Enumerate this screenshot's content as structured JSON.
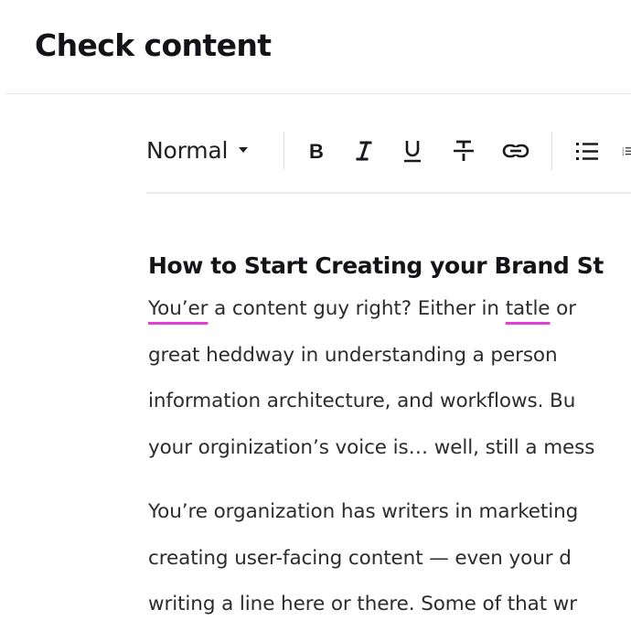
{
  "header": {
    "title": "Check content"
  },
  "toolbar": {
    "format_selected": "Normal",
    "buttons": [
      {
        "name": "bold",
        "icon": "bold-icon"
      },
      {
        "name": "italic",
        "icon": "italic-icon"
      },
      {
        "name": "underline",
        "icon": "underline-icon"
      },
      {
        "name": "strikethrough",
        "icon": "strikethrough-icon"
      },
      {
        "name": "link",
        "icon": "link-icon"
      },
      {
        "name": "bulleted-list",
        "icon": "bulleted-list-icon"
      },
      {
        "name": "numbered-list",
        "icon": "numbered-list-icon"
      }
    ]
  },
  "editor": {
    "heading": "How to Start Creating your Brand St",
    "paragraphs": [
      {
        "lines": [
          {
            "segments": [
              {
                "text": "You’er",
                "misspelled": true
              },
              {
                "text": " a content guy right? Either in "
              },
              {
                "text": "tatle",
                "misspelled": true
              },
              {
                "text": " or"
              }
            ]
          },
          {
            "segments": [
              {
                "text": "great heddway in understanding a person"
              }
            ]
          },
          {
            "segments": [
              {
                "text": "information architecture, and workflows. Bu"
              }
            ]
          },
          {
            "segments": [
              {
                "text": "your orginization’s voice is… well, still a mess"
              }
            ]
          }
        ]
      },
      {
        "lines": [
          {
            "segments": [
              {
                "text": "You’re organization has writers in marketing"
              }
            ]
          },
          {
            "segments": [
              {
                "text": "creating user-facing content — even your d"
              }
            ]
          },
          {
            "segments": [
              {
                "text": "writing a line here or there. Some of that wr"
              }
            ]
          }
        ]
      }
    ]
  },
  "colors": {
    "spellcheck_underline": "#e23fd6",
    "divider": "#e8e8ec",
    "text": "#2b2b30",
    "title": "#141418"
  }
}
